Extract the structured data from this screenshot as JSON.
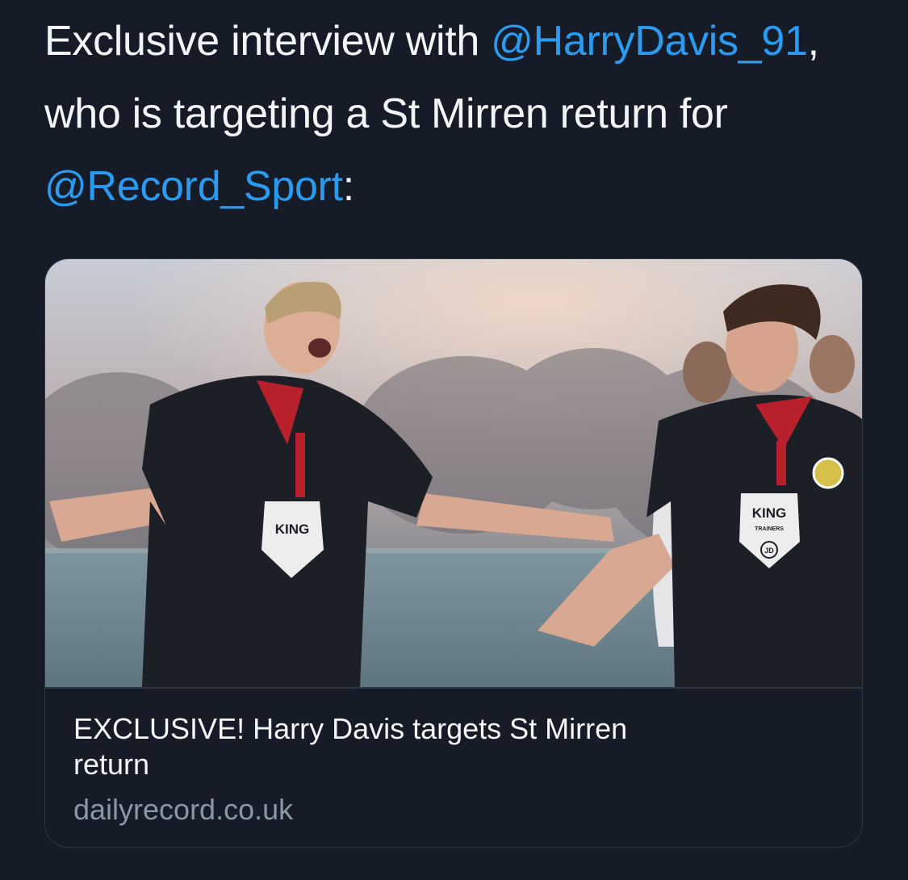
{
  "tweet": {
    "text_before": "Exclusive interview with ",
    "mention_player": "@HarryDavis_91",
    "text_middle": ", who is targeting a St Mirren return for ",
    "mention_outlet": "@Record_Sport",
    "text_after": ":"
  },
  "link_card": {
    "title": "EXCLUSIVE! Harry Davis targets St Mirren return",
    "domain": "dailyrecord.co.uk",
    "image_description": "",
    "image_badge_text": "KING",
    "image_badge_subtext": "TRAINERS",
    "image_badge_mark": "JD"
  },
  "colors": {
    "background": "#151c28",
    "mention": "#2a9bf0",
    "domain": "#8a97a6"
  }
}
